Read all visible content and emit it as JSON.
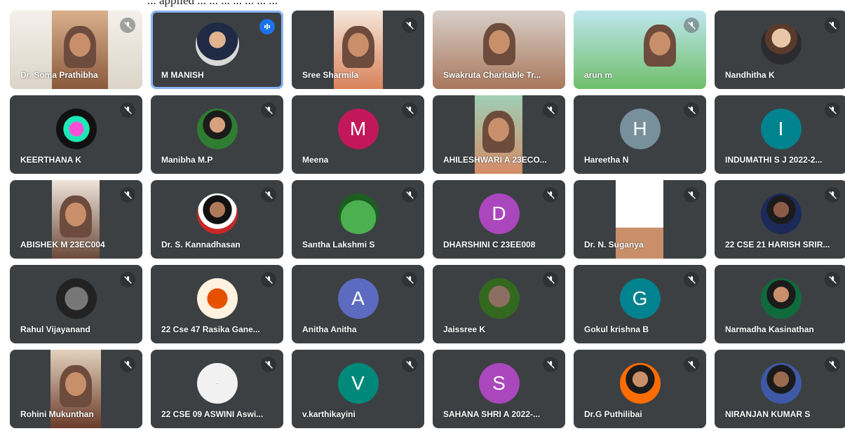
{
  "header": {
    "caption_fragment": "... applied ... ... ... ... ... ... ..."
  },
  "icons": {
    "muted": "mic-off-icon",
    "speaking": "audio-level-icon"
  },
  "colors": {
    "tile_bg": "#3c4043",
    "active_border": "#8ab4f8",
    "speaking_badge": "#1a73e8"
  },
  "participants": [
    {
      "name": "Dr. Soma Prathibha",
      "avatar": "video",
      "muted": true
    },
    {
      "name": "M MANISH",
      "avatar": "photo",
      "muted": false,
      "speaking": true
    },
    {
      "name": "Sree Sharmila",
      "avatar": "video",
      "muted": true
    },
    {
      "name": "Swakruta Charitable Tr...",
      "avatar": "video",
      "muted": false
    },
    {
      "name": "arun m",
      "avatar": "video",
      "muted": true
    },
    {
      "name": "Nandhitha K",
      "avatar": "photo",
      "muted": true
    },
    {
      "name": "KEERTHANA K",
      "avatar": "photo",
      "muted": true
    },
    {
      "name": "Manibha M.P",
      "avatar": "photo",
      "muted": true
    },
    {
      "name": "Meena",
      "avatar": "letter",
      "letter": "M",
      "color": "#c2185b",
      "muted": true
    },
    {
      "name": "AHILESHWARI A 23ECO...",
      "avatar": "video",
      "muted": true
    },
    {
      "name": "Hareetha N",
      "avatar": "letter",
      "letter": "H",
      "color": "#78909c",
      "muted": true
    },
    {
      "name": "INDUMATHI S J 2022-2...",
      "avatar": "letter",
      "letter": "I",
      "color": "#00838f",
      "muted": true
    },
    {
      "name": "ABISHEK M 23EC004",
      "avatar": "video",
      "muted": true
    },
    {
      "name": "Dr. S. Kannadhasan",
      "avatar": "photo",
      "muted": true
    },
    {
      "name": "Santha Lakshmi S",
      "avatar": "photo",
      "muted": true
    },
    {
      "name": "DHARSHINI C 23EE008",
      "avatar": "letter",
      "letter": "D",
      "color": "#ab47bc",
      "muted": true
    },
    {
      "name": "Dr. N. Suganya",
      "avatar": "video",
      "muted": true
    },
    {
      "name": "22 CSE 21 HARISH SRIR...",
      "avatar": "photo",
      "muted": true
    },
    {
      "name": "Rahul Vijayanand",
      "avatar": "photo",
      "muted": true
    },
    {
      "name": "22 Cse 47 Rasika Gane...",
      "avatar": "photo",
      "muted": true
    },
    {
      "name": "Anitha Anitha",
      "avatar": "letter",
      "letter": "A",
      "color": "#5c6bc0",
      "muted": true
    },
    {
      "name": "Jaissree K",
      "avatar": "photo",
      "muted": true
    },
    {
      "name": "Gokul krishna B",
      "avatar": "letter",
      "letter": "G",
      "color": "#00838f",
      "muted": true
    },
    {
      "name": "Narmadha Kasinathan",
      "avatar": "photo",
      "muted": true
    },
    {
      "name": "Rohini Mukunthan",
      "avatar": "video",
      "muted": true
    },
    {
      "name": "22 CSE 09 ASWINI Aswi...",
      "avatar": "photo",
      "muted": true
    },
    {
      "name": "v.karthikayini",
      "avatar": "letter",
      "letter": "V",
      "color": "#00897b",
      "muted": true
    },
    {
      "name": "SAHANA SHRI A 2022-...",
      "avatar": "letter",
      "letter": "S",
      "color": "#ab47bc",
      "muted": true
    },
    {
      "name": "Dr.G Puthilibai",
      "avatar": "photo",
      "muted": true
    },
    {
      "name": "NIRANJAN KUMAR S",
      "avatar": "photo",
      "muted": true
    }
  ]
}
